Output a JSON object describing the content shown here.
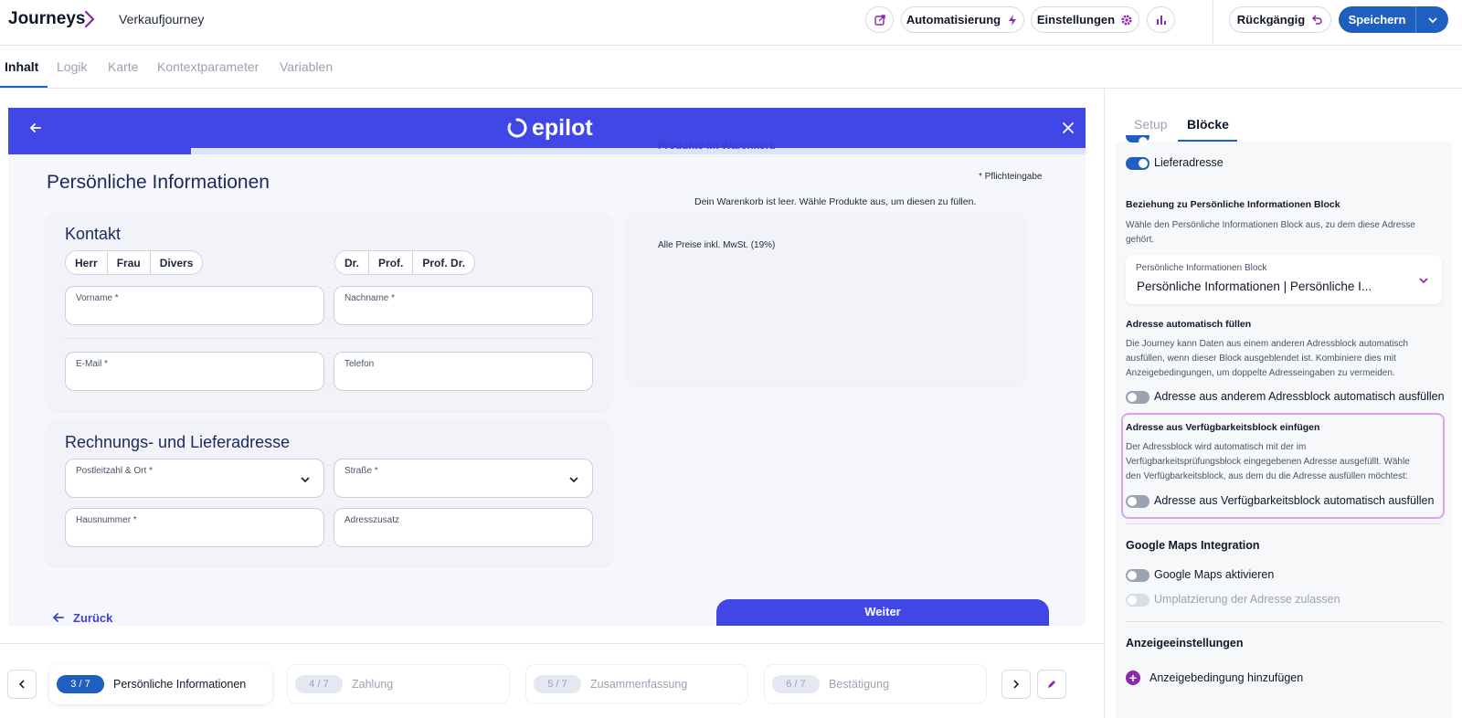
{
  "header": {
    "root": "Journeys",
    "page": "Verkaufjourney",
    "automation_label": "Automatisierung",
    "settings_label": "Einstellungen",
    "undo_label": "Rückgängig",
    "save_label": "Speichern"
  },
  "tabs": [
    {
      "label": "Inhalt"
    },
    {
      "label": "Logik"
    },
    {
      "label": "Karte"
    },
    {
      "label": "Kontextparameter"
    },
    {
      "label": "Variablen"
    }
  ],
  "preview": {
    "brand": "epilot",
    "progress_fraction": 0.17,
    "title": "Persönliche Informationen",
    "required_hint": "* Pflichteingabe",
    "contact": {
      "title": "Kontakt",
      "salutations": [
        "Herr",
        "Frau",
        "Divers"
      ],
      "titles": [
        "Dr.",
        "Prof.",
        "Prof. Dr."
      ],
      "first_name": "Vorname *",
      "last_name": "Nachname *",
      "email": "E-Mail *",
      "phone": "Telefon"
    },
    "address": {
      "title": "Rechnungs- und Lieferadresse",
      "zip_city": "Postleitzahl & Ort *",
      "street": "Straße *",
      "house_number": "Hausnummer *",
      "addition": "Adresszusatz"
    },
    "cart": {
      "title": "Produkte im Warenkorb",
      "empty": "Dein Warenkorb ist leer. Wähle Produkte aus, um diesen zu füllen.",
      "prices": "Alle Preise inkl. MwSt. (19%)"
    },
    "back_label": "Zurück",
    "next_label": "Weiter"
  },
  "steps": [
    {
      "badge": "3 / 7",
      "label": "Persönliche Informationen",
      "active": true
    },
    {
      "badge": "4 / 7",
      "label": "Zahlung",
      "active": false
    },
    {
      "badge": "5 / 7",
      "label": "Zusammenfassung",
      "active": false
    },
    {
      "badge": "6 / 7",
      "label": "Bestätigung",
      "active": false
    }
  ],
  "panel": {
    "tabs": [
      "Setup",
      "Blöcke"
    ],
    "delivery_toggle": "Lieferadresse",
    "relation_heading": "Beziehung zu Persönliche Informationen Block",
    "relation_desc_1": "Wähle den Persönliche Informationen Block aus, zu dem diese Adresse",
    "relation_desc_2": "gehört.",
    "select_label": "Persönliche Informationen Block",
    "select_value": "Persönliche Informationen | Persönliche I...",
    "autofill_heading": "Adresse automatisch füllen",
    "autofill_desc_1": "Die Journey kann Daten aus einem anderen Adressblock automatisch",
    "autofill_desc_2": "ausfüllen, wenn dieser Block ausgeblendet ist. Kombiniere dies mit",
    "autofill_desc_3": "Anzeigebedingungen, um doppelte Adresseingaben zu vermeiden.",
    "autofill_toggle": "Adresse aus anderem Adressblock automatisch ausfüllen",
    "avail_heading": "Adresse aus Verfügbarkeitsblock einfügen",
    "avail_desc_1": "Der Adressblock wird automatisch mit der im",
    "avail_desc_2": "Verfügbarkeitsprüfungsblock eingegebenen Adresse ausgefüllt. Wähle",
    "avail_desc_3": "den Verfügbarkeitsblock, aus dem du die Adresse ausfüllen möchtest:",
    "avail_toggle": "Adresse aus Verfügbarkeitsblock automatisch ausfüllen",
    "maps_heading": "Google Maps Integration",
    "maps_toggle": "Google Maps aktivieren",
    "relocate_toggle": "Umplatzierung der Adresse zulassen",
    "display_heading": "Anzeigeeinstellungen",
    "add_condition": "Anzeigebedingung hinzufügen"
  },
  "colors": {
    "brand": "#4147e6",
    "primary": "#1f5fbf",
    "highlight": "#d9a3f0"
  }
}
